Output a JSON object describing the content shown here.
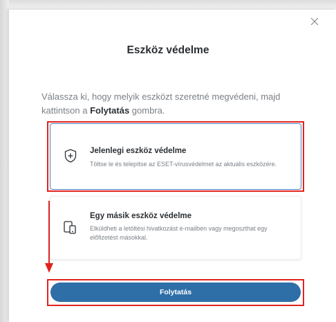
{
  "dialog": {
    "title": "Eszköz védelme",
    "description_lead": "Válassza ki, hogy melyik eszközt szeretné megvédeni, majd kattintson a ",
    "description_bold": "Folytatás",
    "description_tail": " gombra.",
    "close_icon": "close-icon"
  },
  "options": [
    {
      "title": "Jelenlegi eszköz védelme",
      "description": "Töltse le és telepítse az ESET-vírusvédelmet az aktuális eszközére.",
      "icon": "shield-plus-icon",
      "selected": true
    },
    {
      "title": "Egy másik eszköz védelme",
      "description": "Elküldheti a letöltési hivatkozást e-mailben vagy megoszthat egy előfizetést másokkal.",
      "icon": "devices-icon",
      "selected": false
    }
  ],
  "continue_button": {
    "label": "Folytatás"
  },
  "annotations": {
    "highlight_color": "#e0231f",
    "accent": "#2e6fa8"
  }
}
